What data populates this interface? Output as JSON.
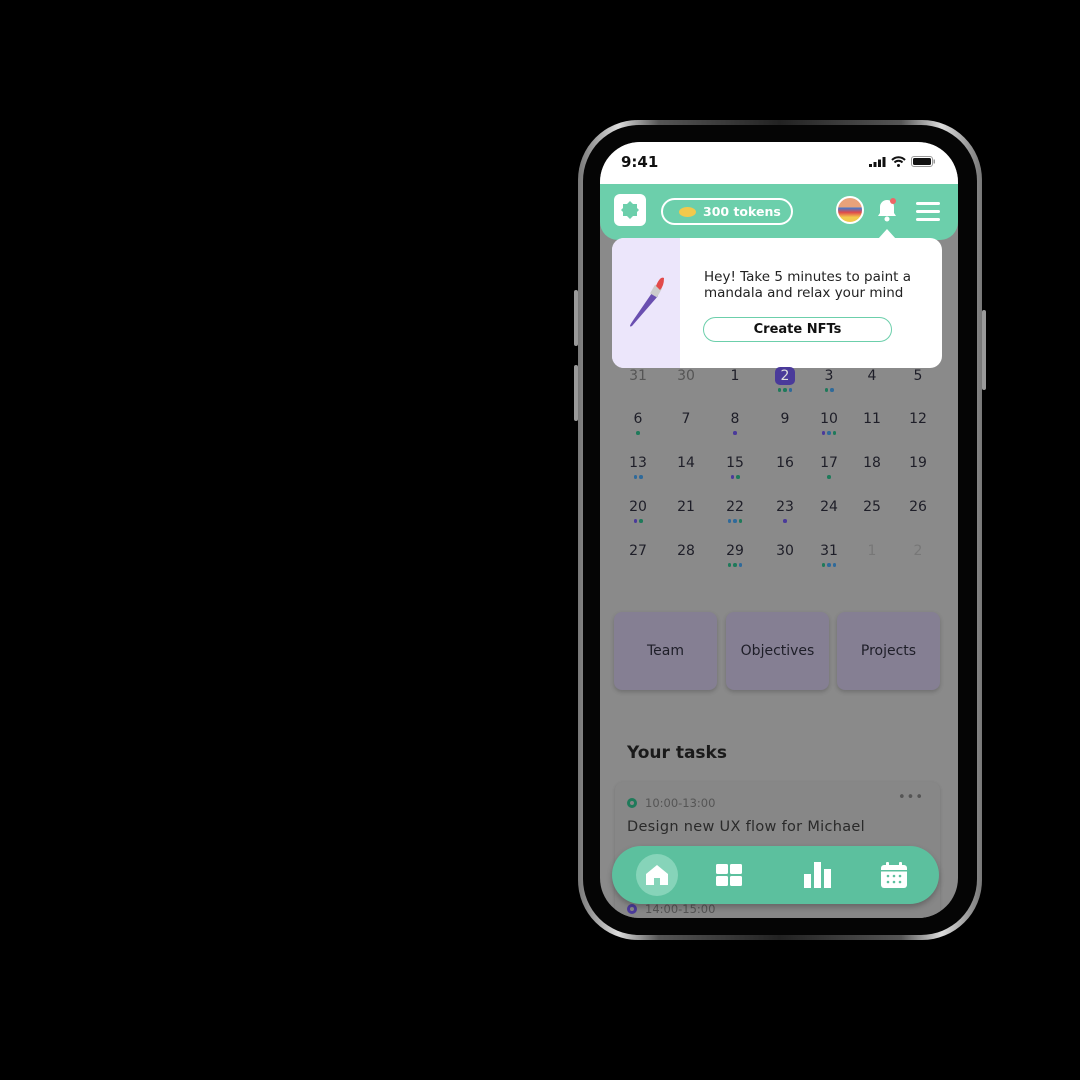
{
  "status": {
    "time": "9:41"
  },
  "header": {
    "tokens": "300 tokens",
    "icons": [
      "app-logo-icon",
      "coin-icon",
      "avatar",
      "bell-icon",
      "menu-icon"
    ],
    "accent": "#6ccfab"
  },
  "popup": {
    "message": "Hey! Take 5 minutes to paint a mandala and relax your mind",
    "button": "Create NFTs",
    "icon": "paintbrush-icon"
  },
  "calendar": {
    "selected": "2",
    "weeks": [
      [
        {
          "d": "31",
          "m": "muted"
        },
        {
          "d": "30",
          "m": "muted"
        },
        {
          "d": "1"
        },
        {
          "d": "2",
          "sel": true,
          "dots": "ggb"
        },
        {
          "d": "3",
          "dots": "gb"
        },
        {
          "d": "4"
        },
        {
          "d": "5"
        }
      ],
      [
        {
          "d": "6",
          "dots": "g"
        },
        {
          "d": "7"
        },
        {
          "d": "8",
          "dots": "p"
        },
        {
          "d": "9"
        },
        {
          "d": "10",
          "dots": "pbg"
        },
        {
          "d": "11"
        },
        {
          "d": "12"
        }
      ],
      [
        {
          "d": "13",
          "dots": "bb"
        },
        {
          "d": "14"
        },
        {
          "d": "15",
          "dots": "pg"
        },
        {
          "d": "16"
        },
        {
          "d": "17",
          "dots": "g"
        },
        {
          "d": "18"
        },
        {
          "d": "19"
        }
      ],
      [
        {
          "d": "20",
          "dots": "pg"
        },
        {
          "d": "21"
        },
        {
          "d": "22",
          "dots": "bbg"
        },
        {
          "d": "23",
          "dots": "p"
        },
        {
          "d": "24"
        },
        {
          "d": "25"
        },
        {
          "d": "26"
        }
      ],
      [
        {
          "d": "27"
        },
        {
          "d": "28"
        },
        {
          "d": "29",
          "dots": "ggb"
        },
        {
          "d": "30"
        },
        {
          "d": "31",
          "dots": "gbb"
        },
        {
          "d": "1",
          "m": "faded"
        },
        {
          "d": "2",
          "m": "faded"
        }
      ]
    ]
  },
  "cards": [
    "Team",
    "Objectives",
    "Projects"
  ],
  "tasks": {
    "title": "Your tasks",
    "items": [
      {
        "time": "10:00-13:00",
        "title": "Design new UX flow for Michael"
      },
      {
        "time": "14:00-15:00"
      }
    ]
  },
  "nav": {
    "items": [
      "home",
      "dashboard",
      "stats",
      "calendar"
    ],
    "active": "home"
  }
}
